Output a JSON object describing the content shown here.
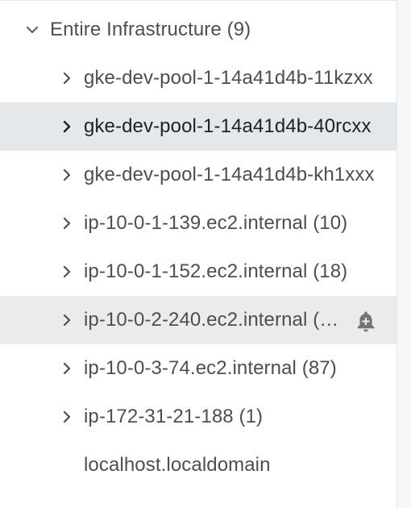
{
  "tree": {
    "root": {
      "label": "Entire Infrastructure (9)",
      "icon": "chevron-down-icon"
    },
    "items": [
      {
        "label": "gke-dev-pool-1-14a41d4b-11kzxx",
        "has_children": true
      },
      {
        "label": "gke-dev-pool-1-14a41d4b-40rcxx",
        "has_children": true,
        "selected": true
      },
      {
        "label": "gke-dev-pool-1-14a41d4b-kh1xxx",
        "has_children": true
      },
      {
        "label": "ip-10-0-1-139.ec2.internal (10)",
        "has_children": true
      },
      {
        "label": "ip-10-0-1-152.ec2.internal (18)",
        "has_children": true
      },
      {
        "label": "ip-10-0-2-240.ec2.internal (…",
        "has_children": true,
        "hover": true,
        "action_icon": "add-alert-bell-icon"
      },
      {
        "label": "ip-10-0-3-74.ec2.internal (87)",
        "has_children": true
      },
      {
        "label": "ip-172-31-21-188 (1)",
        "has_children": true
      },
      {
        "label": "localhost.localdomain",
        "has_children": false
      }
    ]
  },
  "colors": {
    "text": "#4a4f54",
    "selected_bg": "#e5e8ea",
    "hover_bg": "#ebebeb",
    "icon": "#6f767b"
  }
}
